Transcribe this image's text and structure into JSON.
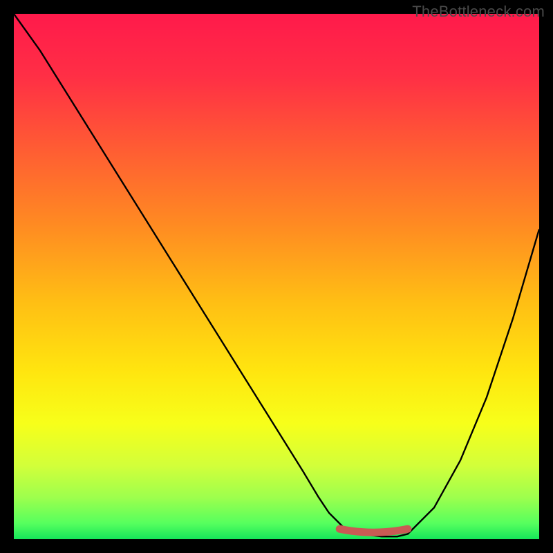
{
  "watermark": "TheBottleneck.com",
  "colors": {
    "background": "#000000",
    "curve": "#000000",
    "marker": "#c95a54",
    "gradient_stops": [
      {
        "offset": 0.0,
        "color": "#ff1a4b"
      },
      {
        "offset": 0.12,
        "color": "#ff2f45"
      },
      {
        "offset": 0.25,
        "color": "#ff5a34"
      },
      {
        "offset": 0.4,
        "color": "#ff8a22"
      },
      {
        "offset": 0.55,
        "color": "#ffbf14"
      },
      {
        "offset": 0.68,
        "color": "#ffe50f"
      },
      {
        "offset": 0.78,
        "color": "#f7ff1a"
      },
      {
        "offset": 0.86,
        "color": "#d2ff3a"
      },
      {
        "offset": 0.92,
        "color": "#9eff4d"
      },
      {
        "offset": 0.97,
        "color": "#56ff5e"
      },
      {
        "offset": 1.0,
        "color": "#15e65a"
      }
    ]
  },
  "chart_data": {
    "type": "line",
    "title": "",
    "xlabel": "",
    "ylabel": "",
    "xlim": [
      0,
      100
    ],
    "ylim": [
      0,
      100
    ],
    "grid": false,
    "series": [
      {
        "name": "bottleneck-curve",
        "x": [
          0,
          5,
          10,
          15,
          20,
          25,
          30,
          35,
          40,
          45,
          50,
          55,
          58,
          60,
          63,
          66,
          70,
          73,
          75,
          80,
          85,
          90,
          95,
          100
        ],
        "y": [
          100,
          93,
          85,
          77,
          69,
          61,
          53,
          45,
          37,
          29,
          21,
          13,
          8,
          5,
          2,
          1,
          0.5,
          0.5,
          1,
          6,
          15,
          27,
          42,
          59
        ]
      }
    ],
    "optimal_zone": {
      "x_start": 62,
      "x_end": 75,
      "y": 0.5
    }
  }
}
